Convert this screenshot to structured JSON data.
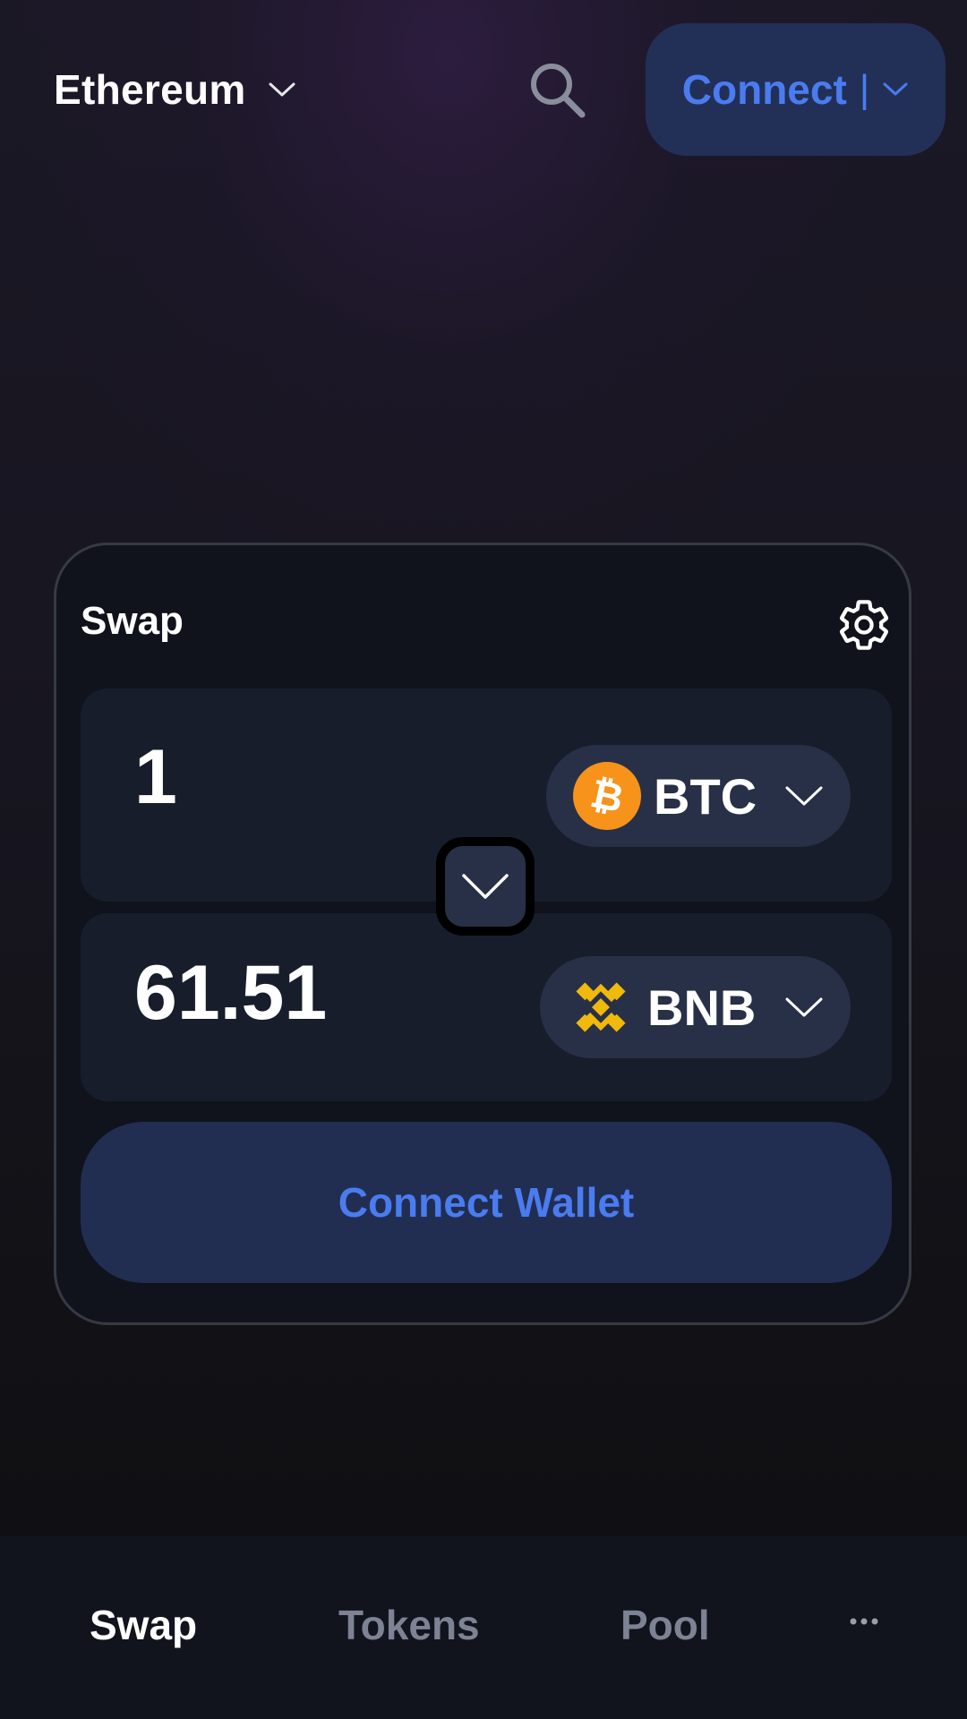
{
  "header": {
    "network_label": "Ethereum",
    "connect_label": "Connect",
    "connect_divider": "|"
  },
  "swap": {
    "title": "Swap",
    "from": {
      "amount": "1",
      "token_symbol": "BTC",
      "token_icon": "bitcoin-icon"
    },
    "to": {
      "amount": "61.51",
      "token_symbol": "BNB",
      "token_icon": "bnb-icon"
    },
    "action_label": "Connect Wallet"
  },
  "nav": {
    "items": [
      {
        "label": "Swap",
        "active": true
      },
      {
        "label": "Tokens",
        "active": false
      },
      {
        "label": "Pool",
        "active": false
      }
    ],
    "more_icon": "more-dots-icon"
  },
  "colors": {
    "accent": "#4a7cf0",
    "button_bg": "#223058",
    "bitcoin_orange": "#f7931a",
    "bnb_gold": "#f0b90b"
  }
}
